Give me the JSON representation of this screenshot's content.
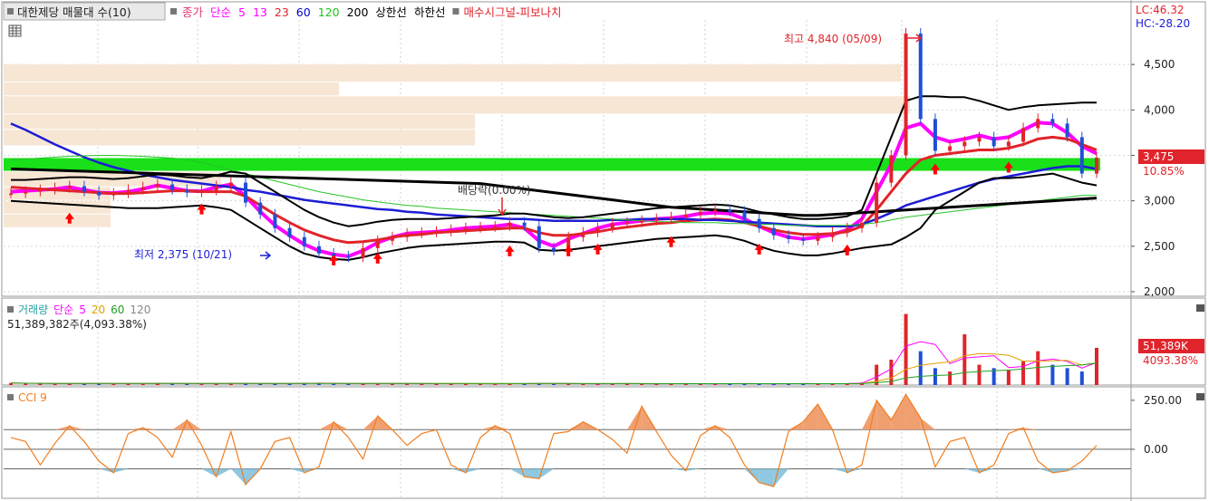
{
  "header": {
    "stock_name": "대한제당 매물대 수(10)",
    "legend": [
      {
        "label": "종가",
        "color": "#e8336b"
      },
      {
        "label": "단순",
        "color": "#ff00ff"
      },
      {
        "label": "5",
        "color": "#ff00ff"
      },
      {
        "label": "13",
        "color": "#ff00ff"
      },
      {
        "label": "23",
        "color": "#e0242b"
      },
      {
        "label": "60",
        "color": "#0000cc"
      },
      {
        "label": "120",
        "color": "#22c322"
      },
      {
        "label": "200",
        "color": "#000000"
      },
      {
        "label": "상한선",
        "color": "#000000"
      },
      {
        "label": "하한선",
        "color": "#000000"
      }
    ],
    "signal_label": "매수시그널-피보나치",
    "lc": "LC:46.32",
    "hc": "HC:-28.20"
  },
  "price_panel": {
    "high_annotation": "최고 4,840 (05/09)",
    "low_annotation": "최저 2,375 (10/21)",
    "dividend_annotation": "배당락(0.00%)",
    "current_price": "3,475",
    "current_change": "10.85%",
    "y_ticks": [
      "4,500",
      "4,000",
      "3,500",
      "3,000",
      "2,500",
      "2,000"
    ]
  },
  "volume_panel": {
    "title": "거래량",
    "legend": [
      {
        "label": "단순",
        "color": "#ff00ff"
      },
      {
        "label": "5",
        "color": "#ff00ff"
      },
      {
        "label": "20",
        "color": "#e0a000"
      },
      {
        "label": "60",
        "color": "#22a022"
      },
      {
        "label": "120",
        "color": "#888888"
      }
    ],
    "summary": "51,389,382주(4,093.38%)",
    "current_volume": "51,389K",
    "current_pct": "4093.38%"
  },
  "cci_panel": {
    "title": "CCI 9",
    "y_ticks": [
      "250.00",
      "0.00"
    ]
  },
  "chart_data": {
    "type": "candlestick",
    "title": "대한제당 매물대 수(10)",
    "ylim": [
      1950,
      4950
    ],
    "y_ticks": [
      2000,
      2500,
      3000,
      3500,
      4000,
      4500
    ],
    "series": [
      {
        "name": "종가",
        "values": [
          3080,
          3100,
          3120,
          3140,
          3160,
          3100,
          3060,
          3080,
          3120,
          3150,
          3180,
          3120,
          3090,
          3110,
          3160,
          3200,
          2980,
          2850,
          2700,
          2600,
          2500,
          2420,
          2390,
          2375,
          2480,
          2560,
          2600,
          2640,
          2650,
          2660,
          2680,
          2700,
          2710,
          2720,
          2760,
          2720,
          2480,
          2450,
          2600,
          2650,
          2700,
          2750,
          2760,
          2780,
          2800,
          2820,
          2850,
          2880,
          2900,
          2880,
          2800,
          2700,
          2620,
          2580,
          2560,
          2600,
          2650,
          2700,
          2760,
          3200,
          3500,
          4840,
          3900,
          3550,
          3600,
          3650,
          3700,
          3600,
          3650,
          3800,
          3900,
          3850,
          3700,
          3300,
          3475
        ]
      },
      {
        "name": "5",
        "values": [
          3100,
          3110,
          3120,
          3130,
          3150,
          3120,
          3090,
          3085,
          3100,
          3130,
          3170,
          3140,
          3110,
          3105,
          3150,
          3180,
          3050,
          2880,
          2730,
          2620,
          2520,
          2450,
          2410,
          2390,
          2450,
          2540,
          2600,
          2640,
          2650,
          2660,
          2680,
          2700,
          2710,
          2720,
          2740,
          2700,
          2560,
          2500,
          2580,
          2640,
          2700,
          2740,
          2760,
          2780,
          2800,
          2810,
          2830,
          2860,
          2870,
          2860,
          2800,
          2720,
          2650,
          2600,
          2580,
          2600,
          2630,
          2680,
          2800,
          3100,
          3400,
          3800,
          3850,
          3700,
          3650,
          3680,
          3720,
          3680,
          3700,
          3780,
          3860,
          3850,
          3750,
          3600,
          3520
        ]
      },
      {
        "name": "23",
        "values": [
          3150,
          3140,
          3130,
          3120,
          3110,
          3100,
          3090,
          3080,
          3080,
          3090,
          3100,
          3110,
          3110,
          3100,
          3100,
          3100,
          3050,
          2950,
          2850,
          2760,
          2680,
          2620,
          2570,
          2540,
          2550,
          2570,
          2600,
          2620,
          2630,
          2650,
          2660,
          2670,
          2680,
          2690,
          2700,
          2700,
          2650,
          2620,
          2620,
          2640,
          2660,
          2690,
          2710,
          2730,
          2750,
          2760,
          2780,
          2790,
          2800,
          2790,
          2760,
          2720,
          2680,
          2650,
          2630,
          2630,
          2640,
          2660,
          2720,
          2900,
          3100,
          3300,
          3450,
          3500,
          3520,
          3540,
          3560,
          3560,
          3580,
          3620,
          3680,
          3700,
          3680,
          3620,
          3560
        ]
      },
      {
        "name": "60",
        "values": [
          3850,
          3780,
          3700,
          3620,
          3550,
          3480,
          3420,
          3370,
          3330,
          3290,
          3260,
          3230,
          3210,
          3190,
          3170,
          3150,
          3120,
          3100,
          3070,
          3040,
          3010,
          2990,
          2970,
          2950,
          2930,
          2910,
          2900,
          2880,
          2870,
          2850,
          2840,
          2830,
          2820,
          2810,
          2800,
          2800,
          2790,
          2780,
          2780,
          2780,
          2780,
          2790,
          2790,
          2800,
          2800,
          2800,
          2800,
          2790,
          2790,
          2780,
          2770,
          2760,
          2750,
          2740,
          2730,
          2720,
          2720,
          2720,
          2740,
          2800,
          2870,
          2950,
          3000,
          3050,
          3100,
          3150,
          3200,
          3240,
          3270,
          3300,
          3330,
          3360,
          3380,
          3380,
          3350
        ]
      },
      {
        "name": "120",
        "values": [
          3450,
          3460,
          3470,
          3480,
          3490,
          3495,
          3500,
          3500,
          3495,
          3490,
          3480,
          3470,
          3450,
          3420,
          3380,
          3340,
          3300,
          3260,
          3220,
          3180,
          3140,
          3100,
          3070,
          3040,
          3010,
          2990,
          2970,
          2950,
          2940,
          2920,
          2910,
          2900,
          2890,
          2880,
          2870,
          2860,
          2850,
          2840,
          2830,
          2820,
          2810,
          2800,
          2790,
          2780,
          2770,
          2770,
          2760,
          2760,
          2760,
          2750,
          2750,
          2740,
          2740,
          2730,
          2730,
          2730,
          2730,
          2730,
          2740,
          2760,
          2790,
          2820,
          2840,
          2860,
          2880,
          2900,
          2920,
          2940,
          2960,
          2980,
          3000,
          3020,
          3040,
          3060,
          3060
        ]
      },
      {
        "name": "200",
        "values": [
          3350,
          3345,
          3340,
          3335,
          3330,
          3325,
          3320,
          3315,
          3310,
          3305,
          3300,
          3295,
          3290,
          3285,
          3280,
          3275,
          3270,
          3265,
          3260,
          3255,
          3250,
          3245,
          3240,
          3235,
          3230,
          3225,
          3220,
          3215,
          3210,
          3205,
          3200,
          3195,
          3190,
          3170,
          3150,
          3130,
          3110,
          3090,
          3070,
          3050,
          3030,
          3010,
          2990,
          2970,
          2950,
          2930,
          2920,
          2910,
          2900,
          2890,
          2880,
          2870,
          2860,
          2850,
          2840,
          2840,
          2850,
          2860,
          2870,
          2880,
          2890,
          2900,
          2910,
          2920,
          2930,
          2940,
          2950,
          2960,
          2970,
          2980,
          2990,
          3000,
          3010,
          3020,
          3030
        ]
      },
      {
        "name": "상한선",
        "values": [
          3230,
          3230,
          3240,
          3250,
          3260,
          3260,
          3250,
          3240,
          3250,
          3270,
          3290,
          3280,
          3260,
          3250,
          3280,
          3320,
          3300,
          3200,
          3100,
          3000,
          2900,
          2820,
          2760,
          2720,
          2740,
          2770,
          2790,
          2800,
          2800,
          2800,
          2810,
          2820,
          2830,
          2840,
          2860,
          2860,
          2840,
          2820,
          2810,
          2820,
          2840,
          2860,
          2880,
          2900,
          2920,
          2930,
          2940,
          2950,
          2960,
          2950,
          2920,
          2880,
          2850,
          2820,
          2800,
          2800,
          2810,
          2830,
          2900,
          3300,
          3700,
          4100,
          4150,
          4150,
          4140,
          4140,
          4100,
          4050,
          4000,
          4030,
          4050,
          4060,
          4070,
          4080,
          4080
        ]
      },
      {
        "name": "하한선",
        "values": [
          3000,
          2990,
          2980,
          2970,
          2960,
          2950,
          2940,
          2930,
          2920,
          2920,
          2920,
          2930,
          2940,
          2950,
          2930,
          2900,
          2800,
          2700,
          2600,
          2500,
          2420,
          2380,
          2360,
          2350,
          2380,
          2420,
          2450,
          2480,
          2500,
          2510,
          2520,
          2530,
          2540,
          2550,
          2550,
          2540,
          2460,
          2450,
          2460,
          2480,
          2500,
          2520,
          2540,
          2560,
          2580,
          2590,
          2600,
          2610,
          2620,
          2600,
          2560,
          2500,
          2450,
          2420,
          2400,
          2400,
          2420,
          2450,
          2480,
          2500,
          2520,
          2600,
          2700,
          2900,
          3000,
          3100,
          3200,
          3250,
          3250,
          3260,
          3280,
          3300,
          3250,
          3200,
          3170
        ]
      }
    ],
    "volume": {
      "name": "거래량",
      "values": [
        1.2,
        0.9,
        1.0,
        0.8,
        0.9,
        1.1,
        1.0,
        0.8,
        0.9,
        1.0,
        1.2,
        0.9,
        0.8,
        0.9,
        1.0,
        1.1,
        0.9,
        0.8,
        0.9,
        1.0,
        1.2,
        1.1,
        0.9,
        0.8,
        0.9,
        1.0,
        0.8,
        0.9,
        0.8,
        0.7,
        0.9,
        0.8,
        0.7,
        0.8,
        0.9,
        0.8,
        1.2,
        0.9,
        0.8,
        0.7,
        0.8,
        0.9,
        0.8,
        0.7,
        0.8,
        0.9,
        0.8,
        0.7,
        0.8,
        0.9,
        0.8,
        0.7,
        0.8,
        0.9,
        0.8,
        0.7,
        0.9,
        1.0,
        1.5,
        12,
        15,
        42,
        20,
        10,
        8,
        30,
        12,
        10,
        9,
        14,
        20,
        12,
        10,
        8,
        22
      ],
      "unit": "백만주"
    },
    "cci": {
      "name": "CCI 9",
      "ylim": [
        -250,
        300
      ],
      "reference_lines": [
        100,
        0,
        -100
      ],
      "values": [
        60,
        40,
        -80,
        30,
        120,
        40,
        -60,
        -120,
        80,
        110,
        60,
        -40,
        150,
        20,
        -140,
        90,
        -180,
        -100,
        40,
        60,
        -120,
        -90,
        140,
        60,
        -50,
        170,
        100,
        20,
        80,
        100,
        -80,
        -120,
        60,
        120,
        80,
        -140,
        -150,
        80,
        90,
        140,
        100,
        50,
        -20,
        220,
        90,
        -30,
        -110,
        70,
        120,
        60,
        -80,
        -170,
        -190,
        90,
        140,
        230,
        100,
        -120,
        -80,
        250,
        150,
        280,
        160,
        -90,
        40,
        60,
        -120,
        -80,
        80,
        110,
        -60,
        -120,
        -110,
        -60,
        20
      ]
    }
  }
}
